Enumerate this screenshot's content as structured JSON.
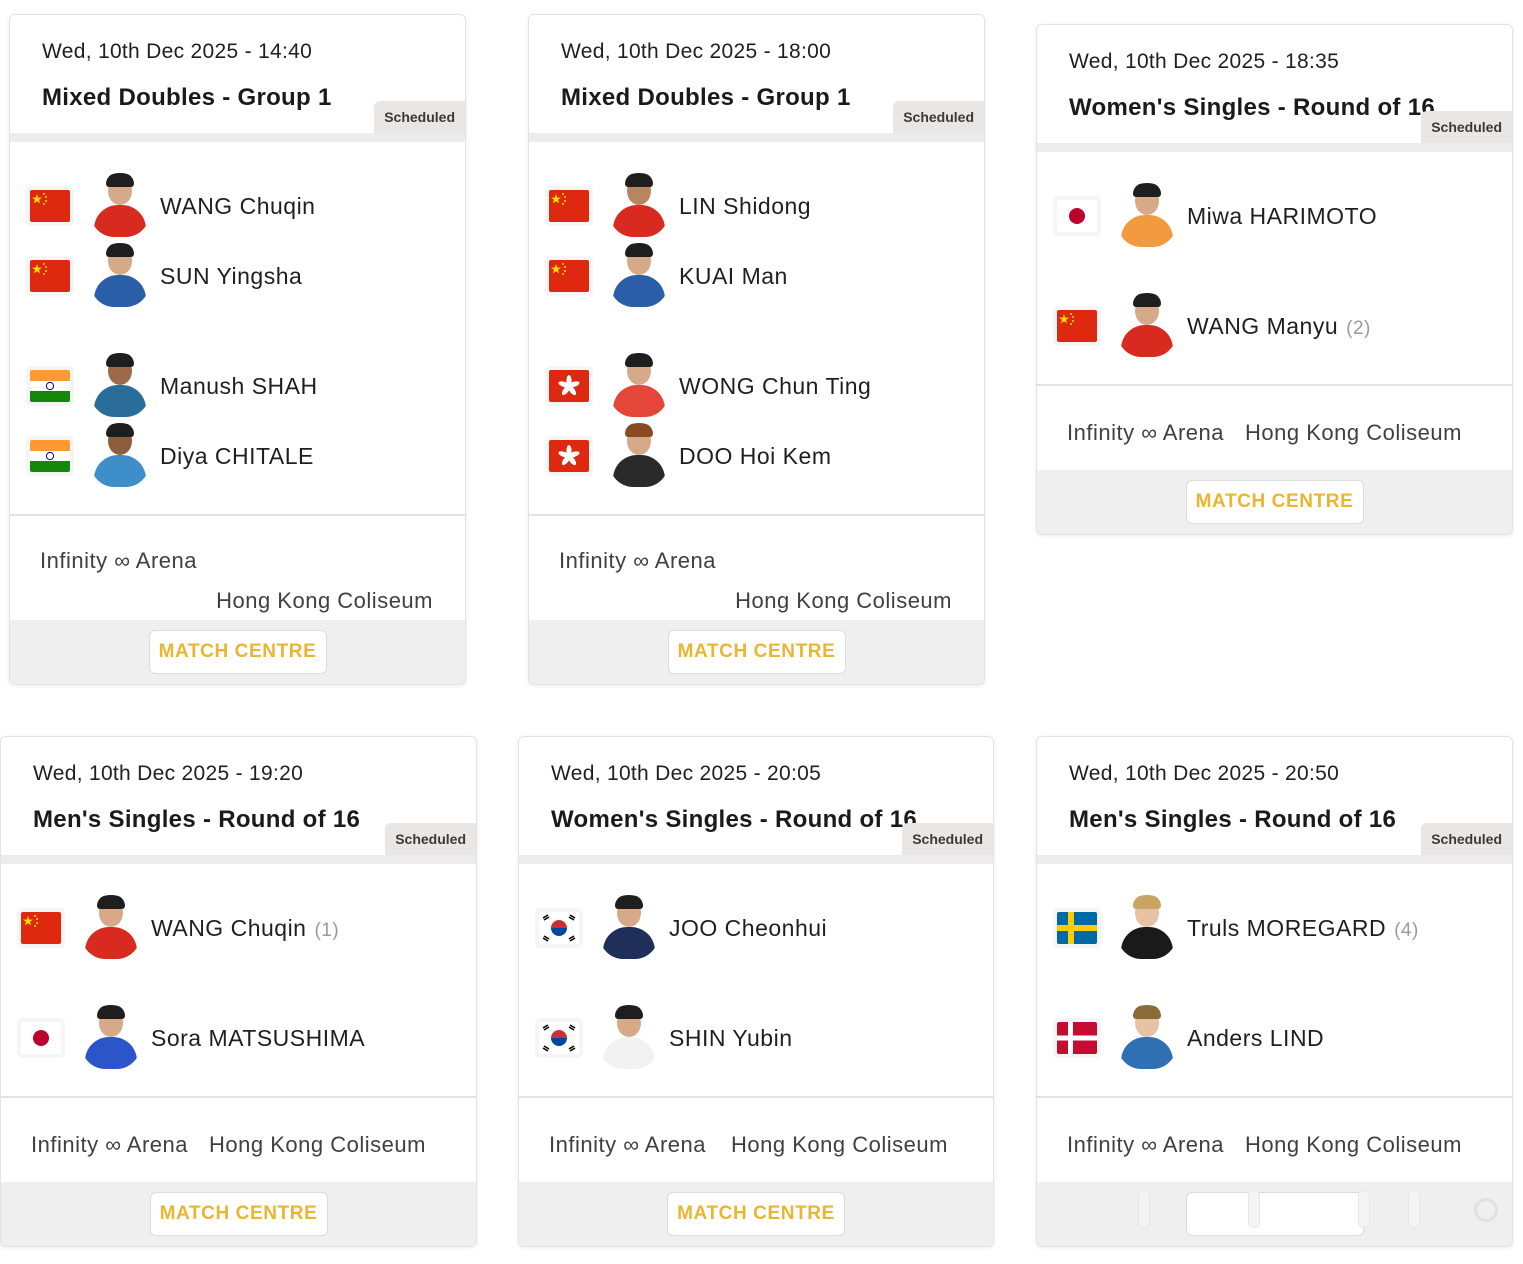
{
  "status_label": "Scheduled",
  "match_centre_label": "MATCH CENTRE",
  "colors": {
    "accent": "#eab531",
    "badge_bg": "#e9e6e3",
    "footer_bg": "#efefef"
  },
  "matches": [
    {
      "datetime": "Wed, 10th Dec 2025 - 14:40",
      "event": "Mixed Doubles - Group 1",
      "status": "Scheduled",
      "players": [
        {
          "name": "WANG Chuqin",
          "country": "China",
          "flag": "china-flag",
          "seed": ""
        },
        {
          "name": "SUN Yingsha",
          "country": "China",
          "flag": "china-flag",
          "seed": ""
        },
        {
          "name": "Manush SHAH",
          "country": "India",
          "flag": "india-flag",
          "seed": ""
        },
        {
          "name": "Diya CHITALE",
          "country": "India",
          "flag": "india-flag",
          "seed": ""
        }
      ],
      "venue": [
        "Infinity ∞ Arena",
        "Hong Kong Coliseum"
      ],
      "button": "MATCH CENTRE"
    },
    {
      "datetime": "Wed, 10th Dec 2025 - 18:00",
      "event": "Mixed Doubles - Group 1",
      "status": "Scheduled",
      "players": [
        {
          "name": "LIN Shidong",
          "country": "China",
          "flag": "china-flag",
          "seed": ""
        },
        {
          "name": "KUAI Man",
          "country": "China",
          "flag": "china-flag",
          "seed": ""
        },
        {
          "name": "WONG Chun Ting",
          "country": "Hong Kong",
          "flag": "hong-kong-flag",
          "seed": ""
        },
        {
          "name": "DOO Hoi Kem",
          "country": "Hong Kong",
          "flag": "hong-kong-flag",
          "seed": ""
        }
      ],
      "venue": [
        "Infinity ∞ Arena",
        "Hong Kong Coliseum"
      ],
      "button": "MATCH CENTRE"
    },
    {
      "datetime": "Wed, 10th Dec 2025 - 18:35",
      "event": "Women's Singles - Round of 16",
      "status": "Scheduled",
      "players": [
        {
          "name": "Miwa HARIMOTO",
          "country": "Japan",
          "flag": "japan-flag",
          "seed": ""
        },
        {
          "name": "WANG Manyu",
          "country": "China",
          "flag": "china-flag",
          "seed": "(2)"
        }
      ],
      "venue": [
        "Infinity ∞ Arena",
        "Hong Kong Coliseum"
      ],
      "button": "MATCH CENTRE"
    },
    {
      "datetime": "Wed, 10th Dec 2025 - 19:20",
      "event": "Men's Singles - Round of 16",
      "status": "Scheduled",
      "players": [
        {
          "name": "WANG Chuqin",
          "country": "China",
          "flag": "china-flag",
          "seed": "(1)"
        },
        {
          "name": "Sora MATSUSHIMA",
          "country": "Japan",
          "flag": "japan-flag",
          "seed": ""
        }
      ],
      "venue": [
        "Infinity ∞ Arena",
        "Hong Kong Coliseum"
      ],
      "button": "MATCH CENTRE"
    },
    {
      "datetime": "Wed, 10th Dec 2025 - 20:05",
      "event": "Women's Singles - Round of 16",
      "status": "Scheduled",
      "players": [
        {
          "name": "JOO Cheonhui",
          "country": "Korea",
          "flag": "korea-flag",
          "seed": ""
        },
        {
          "name": "SHIN Yubin",
          "country": "Korea",
          "flag": "korea-flag",
          "seed": ""
        }
      ],
      "venue": [
        "Infinity ∞ Arena",
        "Hong Kong Coliseum"
      ],
      "button": "MATCH CENTRE"
    },
    {
      "datetime": "Wed, 10th Dec 2025 - 20:50",
      "event": "Men's Singles - Round of 16",
      "status": "Scheduled",
      "players": [
        {
          "name": "Truls MOREGARD",
          "country": "Sweden",
          "flag": "sweden-flag",
          "seed": "(4)"
        },
        {
          "name": "Anders LIND",
          "country": "Denmark",
          "flag": "denmark-flag",
          "seed": ""
        }
      ],
      "venue": [
        "Infinity ∞ Arena",
        "Hong Kong Coliseum"
      ],
      "button": ""
    }
  ]
}
